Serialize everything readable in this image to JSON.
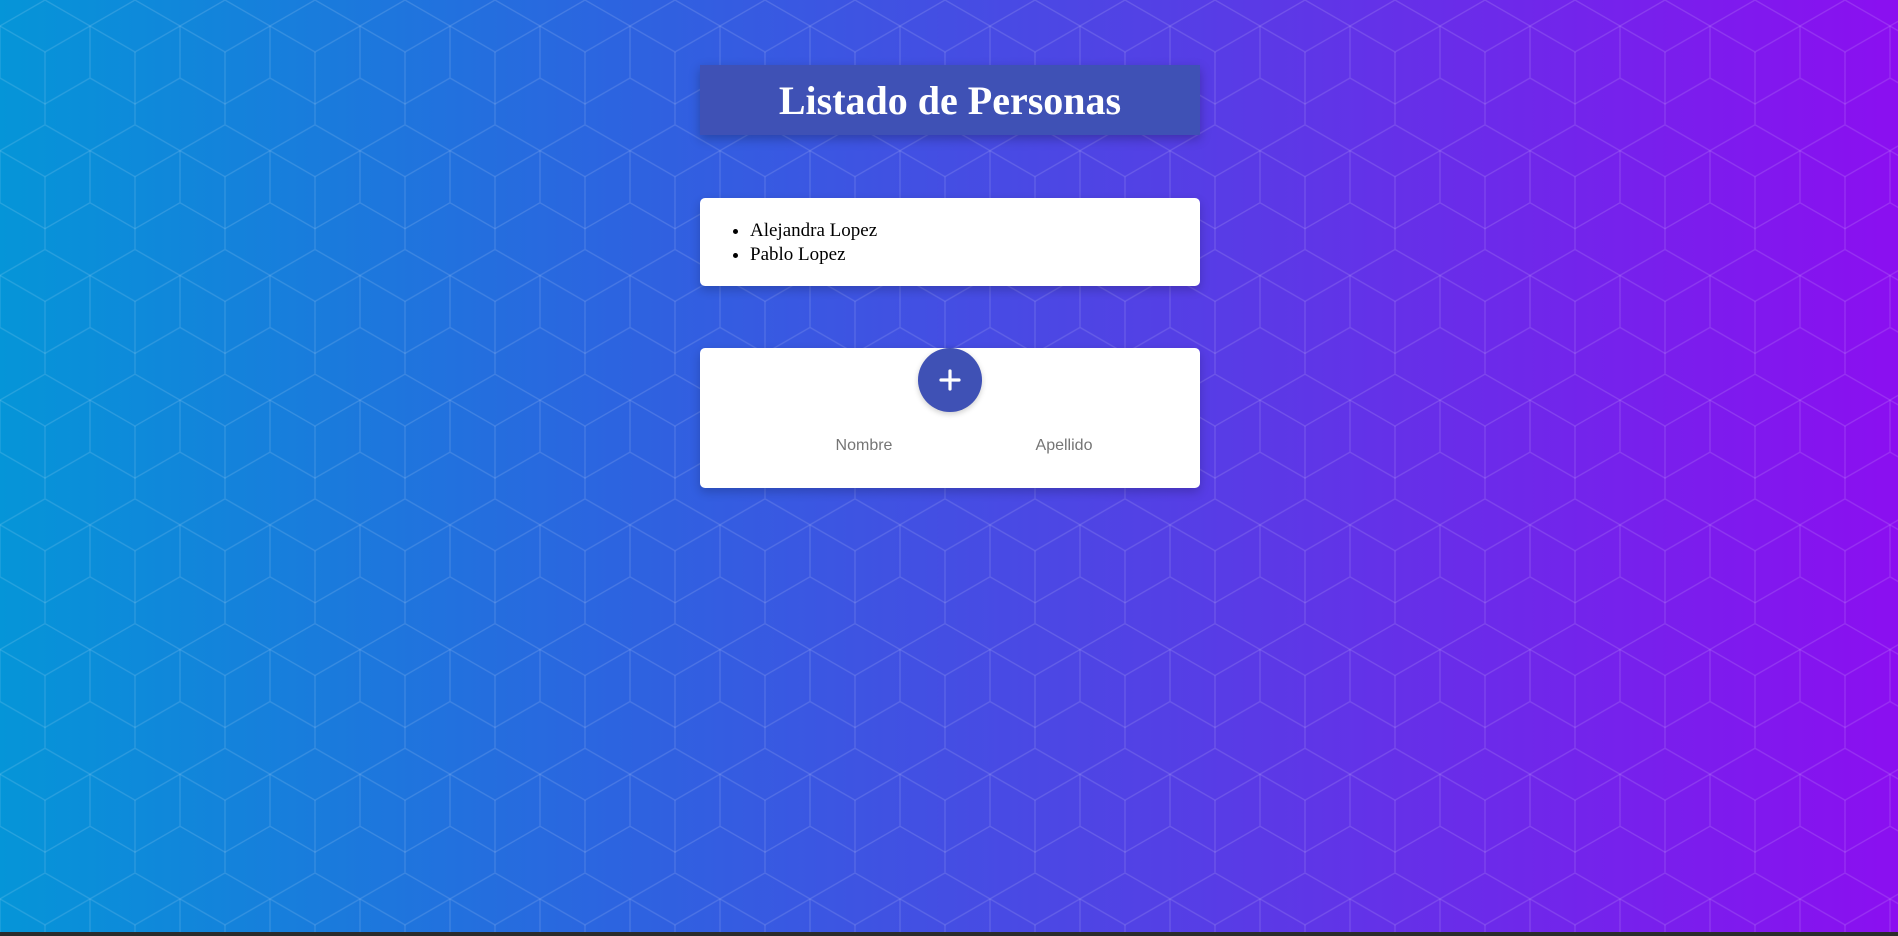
{
  "page": {
    "title": "Listado de Personas"
  },
  "personas": [
    "Alejandra Lopez",
    "Pablo Lopez"
  ],
  "form": {
    "add_button_icon": "plus-icon",
    "nombre": {
      "placeholder": "Nombre",
      "value": ""
    },
    "apellido": {
      "placeholder": "Apellido",
      "value": ""
    }
  },
  "colors": {
    "primary": "#3f51b5",
    "background_start": "#0595d8",
    "background_end": "#8b0ff0",
    "card": "#ffffff"
  }
}
